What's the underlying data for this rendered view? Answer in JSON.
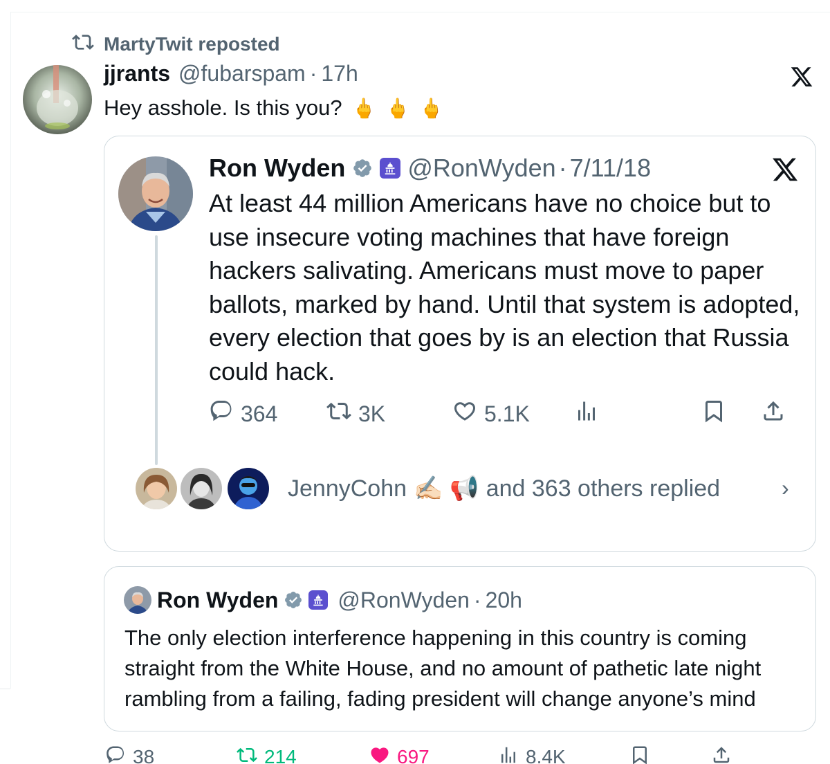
{
  "repost": {
    "label": "MartyTwit reposted"
  },
  "tweet": {
    "display_name": "jjrants",
    "handle": "@fubarspam",
    "sep": "·",
    "time": "17h",
    "text": "Hey asshole. Is this you?",
    "emoji": [
      "🖕",
      "🖕",
      "🖕"
    ]
  },
  "quote1": {
    "display_name": "Ron Wyden",
    "handle": "@RonWyden",
    "sep": "·",
    "date": "7/11/18",
    "text": "At least 44 million Americans have no choice but to use insecure voting machines that have foreign hackers salivating. Americans must move to paper ballots, marked by hand. Until that system is adopted, every election that goes by is an election that Russia could hack.",
    "actions": {
      "replies": "364",
      "reposts": "3K",
      "likes": "5.1K"
    },
    "replied": {
      "names": "JennyCohn",
      "emoji": [
        "✍🏻",
        "📢"
      ],
      "text": "and 363 others replied",
      "chevron": "›"
    }
  },
  "quote2": {
    "display_name": "Ron Wyden",
    "handle": "@RonWyden",
    "sep": "·",
    "time": "20h",
    "text": "The only election interference happening in this country is coming straight from the White House, and no amount of pathetic late night rambling from a failing, fading president will change anyone’s mind"
  },
  "actions": {
    "replies": "38",
    "reposts": "214",
    "likes": "697",
    "views": "8.4K"
  },
  "colors": {
    "muted": "#536471",
    "border": "#cfd9de",
    "verified": "#829aab",
    "repost_green": "#00ba7c",
    "like_pink": "#f91880"
  }
}
